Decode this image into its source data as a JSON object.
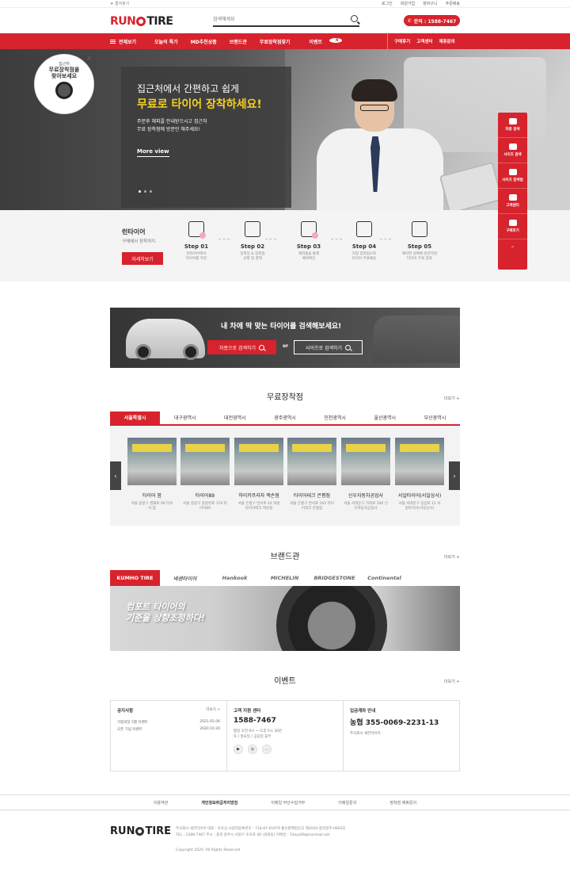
{
  "topbar": {
    "favorite": "★ 즐겨찾기",
    "links": [
      "로그인",
      "회원가입",
      "장바구니",
      "주문배송"
    ]
  },
  "header": {
    "logo_run": "RUN",
    "logo_tire": "TIRE",
    "search_placeholder": "검색해세요",
    "phone_label": "문의 : 1588-7467"
  },
  "nav": {
    "all": "전체보기",
    "menu": [
      "오늘의 특가",
      "MD추천상품",
      "브랜드관",
      "무료장착점찾기",
      "이벤트"
    ],
    "event_badge": "N",
    "right": [
      "구매후기",
      "고객센터",
      "제휴문의"
    ]
  },
  "hero": {
    "line1": "집근처에서 간편하고 쉽게",
    "line2": "무료로 타이어 장착하세요!",
    "desc1": "주문후 해피콜 안내받으시고 집근처",
    "desc2": "무료 장착점에 방문만 해주세요!",
    "more": "More view"
  },
  "badge": {
    "small": "집근처",
    "line1": "무료장착점을",
    "line2": "찾아보세요",
    "close": "×"
  },
  "quick": [
    "차종 검색",
    "사이즈 검색",
    "사이즈 검색법",
    "고객센터",
    "구매후기"
  ],
  "quick_up": "⌃",
  "steps": {
    "title": "런타이어",
    "subtitle": "구매에서 장착까지",
    "button": "자세히보기",
    "items": [
      {
        "title": "Step 01",
        "sub1": "런타이어에서",
        "sub2": "타이어를 주문"
      },
      {
        "title": "Step 02",
        "sub1": "장착일 & 장착점",
        "sub2": "선택 및 결제"
      },
      {
        "title": "Step 03",
        "sub1": "해피콜을 통해",
        "sub2": "예약확인"
      },
      {
        "title": "Step 04",
        "sub1": "지정 장착점으로",
        "sub2": "타이어 무료배송"
      },
      {
        "title": "Step 05",
        "sub1": "예약한 날짜에 방문하면",
        "sub2": "타이어 무료 장착"
      }
    ]
  },
  "tire_search": {
    "title": "내 차에 딱 맞는 타이어를 검색해보세요!",
    "by_car": "차종으로 검색하기",
    "or": "or",
    "by_size": "사이즈로 검색하기"
  },
  "install": {
    "title": "무료장착점",
    "more": "더보기 +",
    "tabs": [
      "서울특별시",
      "대구광역시",
      "대전광역시",
      "광주광역시",
      "인천광역시",
      "울산광역시",
      "부산광역시"
    ],
    "prev": "‹",
    "next": "›",
    "shops": [
      {
        "name": "타이어 팜",
        "addr1": "서울 중랑구 겸재로 96 타이",
        "addr2": "어 팜"
      },
      {
        "name": "타이어89",
        "addr1": "서울 중랑구 중랑천로 119 타",
        "addr2": "이어89"
      },
      {
        "name": "하이카프라자 엑손점",
        "addr1": "서울 은평구 연서로 42 넥센",
        "addr2": "타이어테크 엑손점"
      },
      {
        "name": "타이어테크 은평점",
        "addr1": "서울 은평구 연서로 193 타이",
        "addr2": "어테크 은평점"
      },
      {
        "name": "신우자동차공업사",
        "addr1": "서울 서대문구 가좌로 106 신",
        "addr2": "우자동차공업사"
      },
      {
        "name": "서일타이어(서일상사)",
        "addr1": "서울 서대문구 응암로 11 서",
        "addr2": "일타이어(서일상사)"
      }
    ]
  },
  "brand": {
    "title": "브랜드관",
    "more": "더보기 +",
    "brands": [
      "KUMHO TIRE",
      "넥센타이어",
      "Hankook",
      "MICHELIN",
      "BRIDGESTONE",
      "Continental"
    ],
    "banner1": "컴포트 타이어의",
    "banner2": "기준을 상향조정하다!"
  },
  "event": {
    "title": "이벤트",
    "more": "더보기 +"
  },
  "info": {
    "notice": {
      "title": "공지사항",
      "more": "더보기 +",
      "rows": [
        {
          "text": "가정의달 5월 이벤트",
          "date": "2021.05.06"
        },
        {
          "text": "오픈 기념 이벤트",
          "date": "2020.10.20"
        }
      ]
    },
    "cs": {
      "title": "고객 지원 센터",
      "phone": "1588-7467",
      "hours1": "평일 오전 9시 ~ 오후 5시 30분",
      "hours2": "토 / 일요일 / 공휴일 휴무",
      "sns": [
        "▶",
        "◎",
        "…"
      ]
    },
    "bank": {
      "title": "입금계좌 안내",
      "account": "농협 355-0069-2231-13",
      "holder": "주식회사 세븐타이어"
    }
  },
  "footer": {
    "links": [
      "이용약관",
      "개인정보취급처리방침",
      "이메일 무단수집거부",
      "이메일문의",
      "장착점 제휴문의"
    ],
    "info1": "주식회사 세븐타이어    대표 : 유호상    사업자등록번호 : 718-87-01979    통신판매업신고 제2020-충북청주-0893호",
    "info2": "TEL : 1588-7467    주소 : 충북 청주시 서원구 호호로 46 (성화동)    이메일 : 7days09@hanmail.net",
    "copyright": "Copyright 2020. All Rights Reserved."
  }
}
